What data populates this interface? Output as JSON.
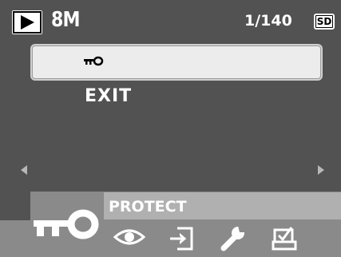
{
  "status": {
    "resolution": "8M",
    "frame_counter": "1/140",
    "card_label": "SD"
  },
  "menu": {
    "items": [
      {
        "icon": "protect-key-icon",
        "label": ""
      },
      {
        "label": "EXIT"
      }
    ]
  },
  "bottom_menu": {
    "current_label": "PROTECT",
    "icons": [
      "protect-key-icon",
      "eye-icon",
      "import-icon",
      "wrench-icon",
      "print-icon"
    ]
  },
  "colors": {
    "background": "#525252",
    "panel": "#8a8a8a",
    "label_bar": "#b0b0b0",
    "highlight": "#ececec"
  }
}
